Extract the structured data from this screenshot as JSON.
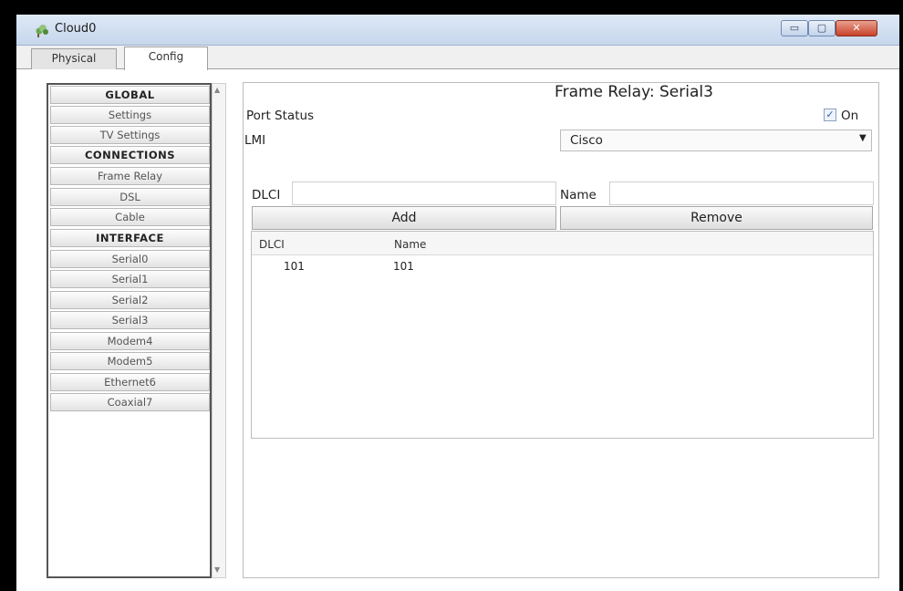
{
  "window": {
    "title": "Cloud0",
    "min_label": "▭",
    "max_label": "▢",
    "close_label": "✕"
  },
  "tabs": [
    {
      "label": "Physical"
    },
    {
      "label": "Config"
    }
  ],
  "nav": [
    {
      "label": "GLOBAL",
      "type": "header"
    },
    {
      "label": "Settings",
      "type": "item"
    },
    {
      "label": "TV Settings",
      "type": "item"
    },
    {
      "label": "CONNECTIONS",
      "type": "header"
    },
    {
      "label": "Frame Relay",
      "type": "item"
    },
    {
      "label": "DSL",
      "type": "item"
    },
    {
      "label": "Cable",
      "type": "item"
    },
    {
      "label": "INTERFACE",
      "type": "header"
    },
    {
      "label": "Serial0",
      "type": "item"
    },
    {
      "label": "Serial1",
      "type": "item"
    },
    {
      "label": "Serial2",
      "type": "item"
    },
    {
      "label": "Serial3",
      "type": "item"
    },
    {
      "label": "Modem4",
      "type": "item"
    },
    {
      "label": "Modem5",
      "type": "item"
    },
    {
      "label": "Ethernet6",
      "type": "item"
    },
    {
      "label": "Coaxial7",
      "type": "item"
    }
  ],
  "panel": {
    "title": "Frame Relay: Serial3",
    "port_status_label": "Port Status",
    "on_label": "On",
    "on_checked": true,
    "lmi_label": "LMI",
    "lmi_value": "Cisco",
    "dlci_label": "DLCI",
    "dlci_value": "",
    "name_label": "Name",
    "name_value": "",
    "add_label": "Add",
    "remove_label": "Remove",
    "table": {
      "columns": [
        "DLCI",
        "Name"
      ],
      "rows": [
        [
          "101",
          "101"
        ]
      ]
    }
  },
  "icons": {
    "app": "cloud-icon",
    "check": "checkmark-icon",
    "dropdown": "chevron-down-icon"
  }
}
